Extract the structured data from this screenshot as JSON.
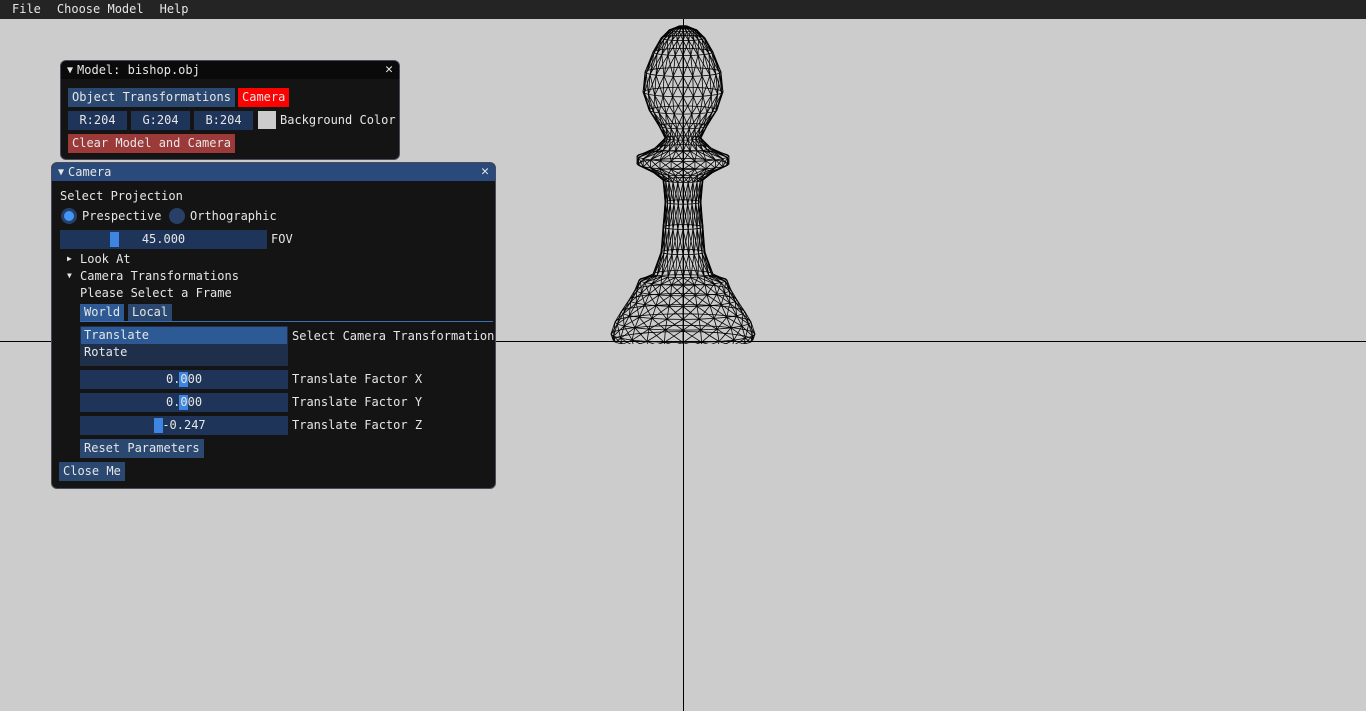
{
  "menubar": {
    "items": [
      "File",
      "Choose Model",
      "Help"
    ]
  },
  "model_window": {
    "title": "Model: bishop.obj",
    "object_transform_btn": "Object Transformations",
    "camera_btn": "Camera",
    "r": "R:204",
    "g": "G:204",
    "b": "B:204",
    "bg_label": "Background Color",
    "clear_btn": "Clear Model and Camera"
  },
  "camera_window": {
    "title": "Camera",
    "projection_label": "Select Projection",
    "perspective": "Prespective",
    "orthographic": "Orthographic",
    "fov_value": "45.000",
    "fov_label": "FOV",
    "look_at": "Look At",
    "cam_transforms": "Camera Transformations",
    "select_frame": "Please Select a Frame",
    "tab_world": "World",
    "tab_local": "Local",
    "list_translate": "Translate",
    "list_rotate": "Rotate",
    "select_transform_label": "Select Camera Transformation",
    "tx_value": "0.000",
    "tx_label": "Translate Factor X",
    "ty_value": "0.000",
    "ty_label": "Translate Factor Y",
    "tz_value": "-0.247",
    "tz_label": "Translate Factor Z",
    "reset_btn": "Reset Parameters",
    "close_btn": "Close Me"
  },
  "colors": {
    "background": "#cccccc",
    "accent": "#4296fa",
    "camera_btn": "#ff0000"
  }
}
